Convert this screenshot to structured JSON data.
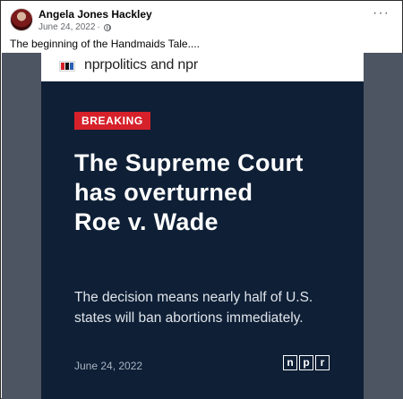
{
  "post": {
    "author": "Angela Jones Hackley",
    "date": "June 24, 2022",
    "visibility_icon": "globe-icon",
    "caption": "The beginning of the Handmaids Tale...."
  },
  "card": {
    "source": "nprpolitics and npr",
    "badge": "BREAKING",
    "headline_1": "The Supreme Court",
    "headline_2": "has overturned",
    "headline_3": "Roe v. Wade",
    "subtext_1": "The decision means nearly half of U.S.",
    "subtext_2": "states will ban abortions immediately.",
    "date": "June 24, 2022",
    "logo_n": "n",
    "logo_p": "p",
    "logo_r": "r"
  },
  "colors": {
    "card_bg": "#0e1f36",
    "badge": "#d6202a",
    "media_bg": "#4e5562"
  }
}
